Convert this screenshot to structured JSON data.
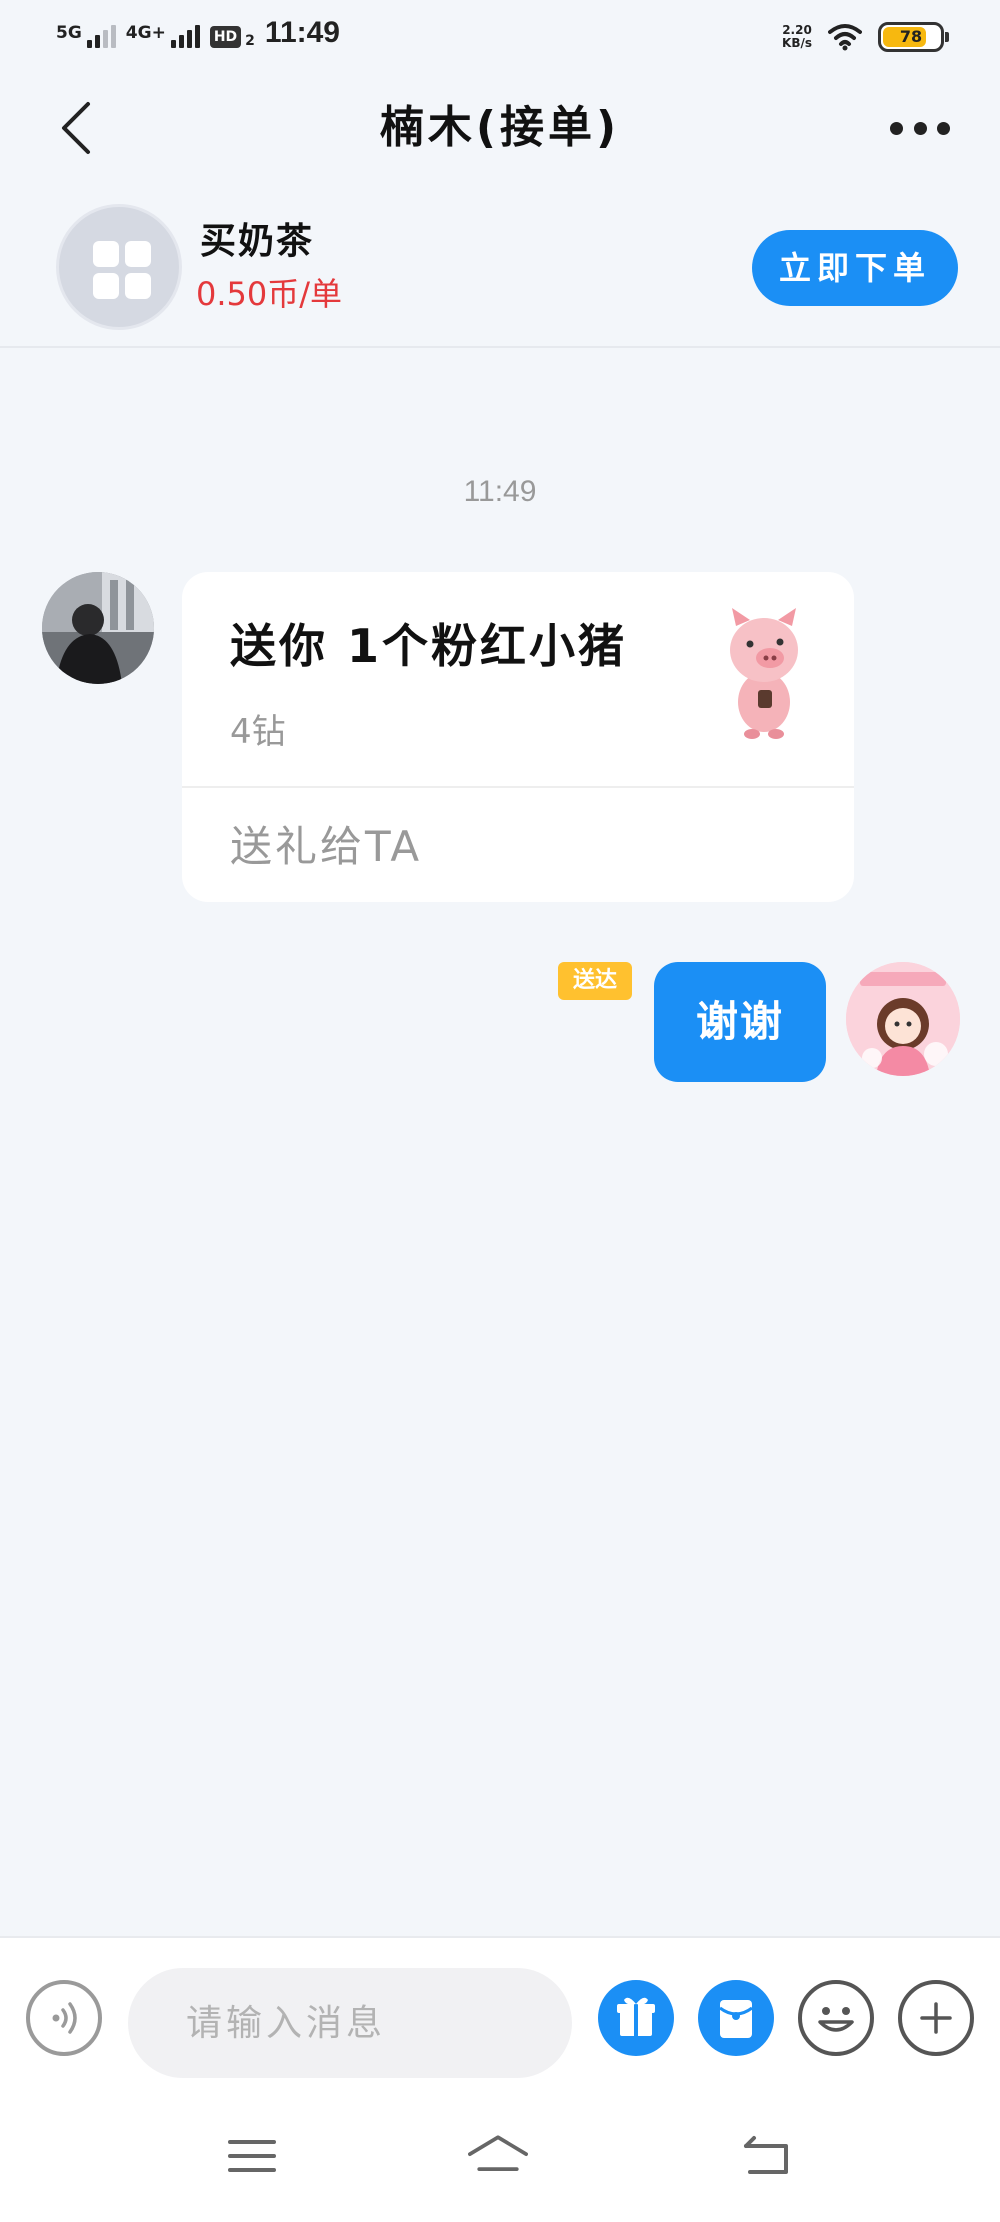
{
  "status_bar": {
    "net1": "5G",
    "net2": "4G+",
    "hd": "HD",
    "hd_sub": "2",
    "time": "11:49",
    "speed_value": "2.20",
    "speed_unit": "KB/s",
    "battery_level": "78",
    "battery_fraction": 0.78,
    "battery_color": "#f7b80f"
  },
  "header": {
    "back_icon": "chevron-left-icon",
    "title": "楠木(接单)",
    "more_icon": "more-dots-icon"
  },
  "product": {
    "name": "买奶茶",
    "price": "0.50币/单",
    "price_color": "#e4393c",
    "order_button": "立即下单",
    "icon": "apps-grid-icon"
  },
  "chat": {
    "timestamp": "11:49",
    "messages": [
      {
        "side": "left",
        "type": "gift",
        "gift_text": "送你 1个粉红小猪",
        "gift_cost": "4钻",
        "gift_action": "送礼给TA",
        "gift_icon": "pink-pig-sticker"
      },
      {
        "side": "right",
        "type": "text",
        "text": "谢谢",
        "status": "送达"
      }
    ]
  },
  "input_bar": {
    "placeholder": "请输入消息",
    "icons": [
      "voice-icon",
      "gift-icon",
      "red-packet-icon",
      "emoji-icon",
      "plus-icon"
    ]
  },
  "nav_bar": {
    "icons": [
      "menu-icon",
      "home-icon",
      "back-icon"
    ]
  },
  "colors": {
    "accent": "#1b8ff5",
    "background": "#f3f6fa",
    "badge": "#ffc12f"
  }
}
